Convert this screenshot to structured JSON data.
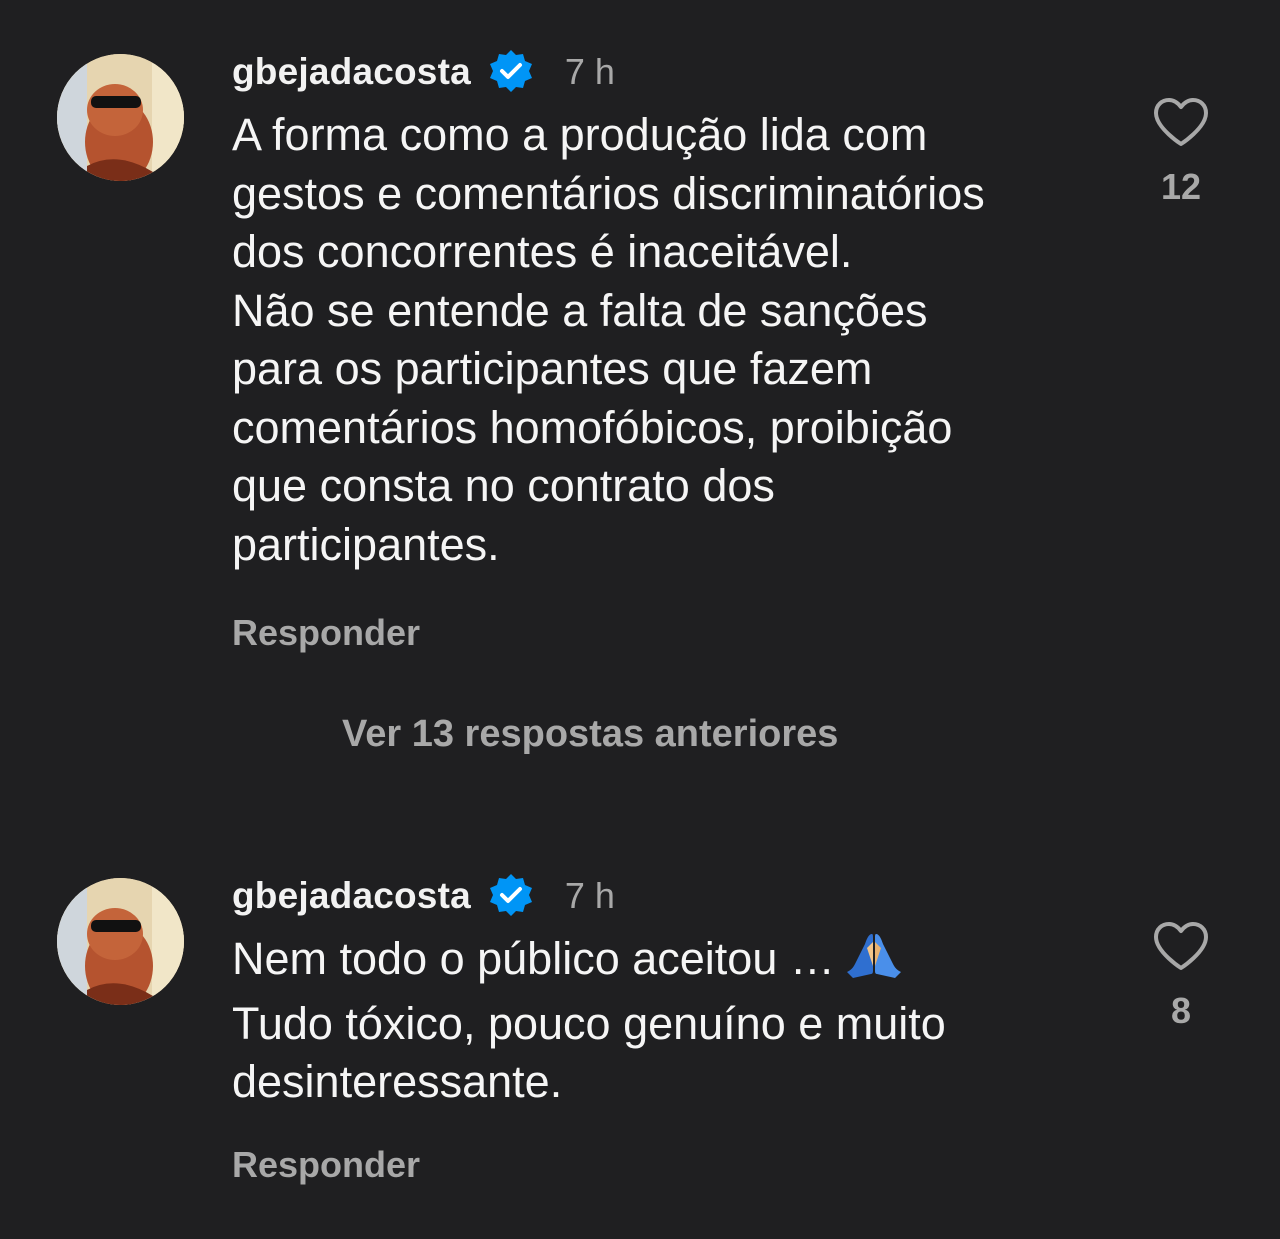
{
  "comments": [
    {
      "username": "gbejadacosta",
      "time": "7 h",
      "text": "A forma como a produção lida com\ngestos e comentários discriminatórios\ndos concorrentes é inaceitável.\nNão se entende a falta de sanções\npara os participantes que fazem\ncomentários homofóbicos, proibição\nque consta no contrato dos\nparticipantes.",
      "reply_label": "Responder",
      "likes": "12"
    },
    {
      "username": "gbejadacosta",
      "time": "7 h",
      "text_line1": "Nem todo o público aceitou …",
      "text_rest": "Tudo tóxico, pouco genuíno e muito\ndesinteressante.",
      "emoji": "🙏",
      "reply_label": "Responder",
      "likes": "8"
    }
  ],
  "view_replies": "Ver 13 respostas anteriores",
  "icons": {
    "verified": "verified-badge-icon",
    "heart": "heart-outline-icon",
    "emoji": "folded-hands-icon"
  },
  "colors": {
    "background": "#1f1f21",
    "text": "#f5f5f5",
    "secondary": "#a8a8a8",
    "verified": "#0095f6"
  }
}
